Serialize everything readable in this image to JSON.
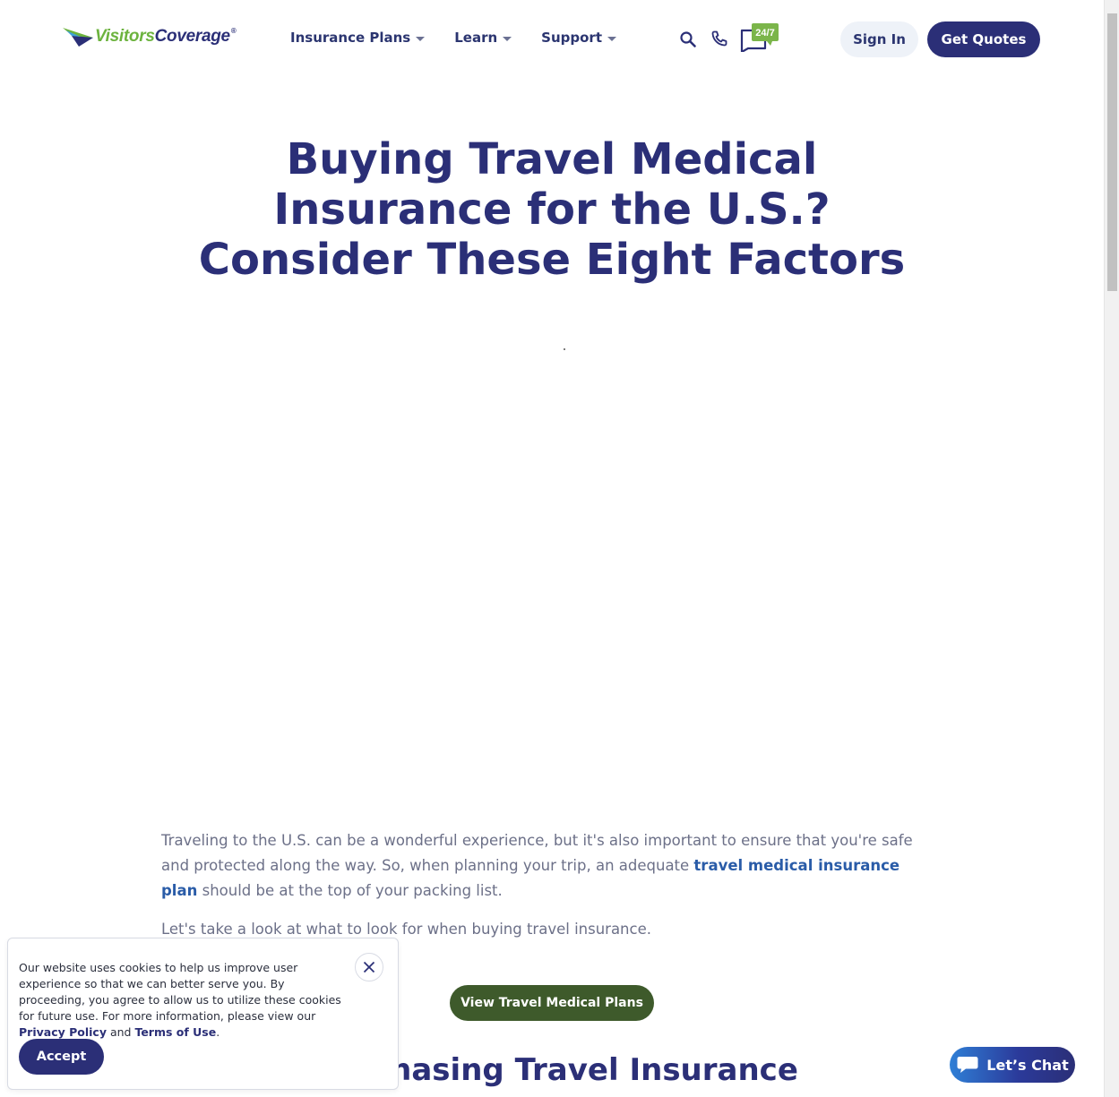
{
  "header": {
    "logo": {
      "part1": "Visitors",
      "part2": "Coverage",
      "reg": "®"
    },
    "nav": [
      {
        "label": "Insurance Plans"
      },
      {
        "label": "Learn"
      },
      {
        "label": "Support"
      }
    ],
    "icons": {
      "search": "search-icon",
      "phone": "phone-icon",
      "chat": "chat-24-7-icon"
    },
    "chat_badge": "24/7",
    "sign_in": "Sign In",
    "get_quotes": "Get Quotes"
  },
  "hero": {
    "title_line1": "Buying Travel Medical",
    "title_line2": "Insurance for the U.S.?",
    "title_line3": "Consider These Eight Factors"
  },
  "article": {
    "p1_before": "Traveling to the U.S. can be a wonderful experience, but it's also important to ensure that you're safe and protected along the way. So, when planning your trip, an adequate ",
    "p1_link": "travel medical insurance plan",
    "p1_after": " should be at the top of your packing list.",
    "p2": "Let's take a look at what to look for when buying travel insurance.",
    "cta": "View Travel Medical Plans",
    "section_heading": "Purchasing Travel Insurance"
  },
  "cookie_banner": {
    "text_before": "Our website uses cookies to help us improve user experience so that we can better serve you. By proceeding, you agree to allow us to utilize these cookies for future use. For more information, please view our ",
    "privacy_link": "Privacy Policy",
    "and": " and ",
    "terms_link": "Terms of Use",
    "period": ".",
    "accept": "Accept"
  },
  "chat_widget": {
    "label": "Let’s Chat"
  },
  "colors": {
    "brand_navy": "#2b2f77",
    "brand_green": "#6cb33e",
    "cta_green": "#3e5a2b",
    "link_blue": "#2a5ca8"
  }
}
